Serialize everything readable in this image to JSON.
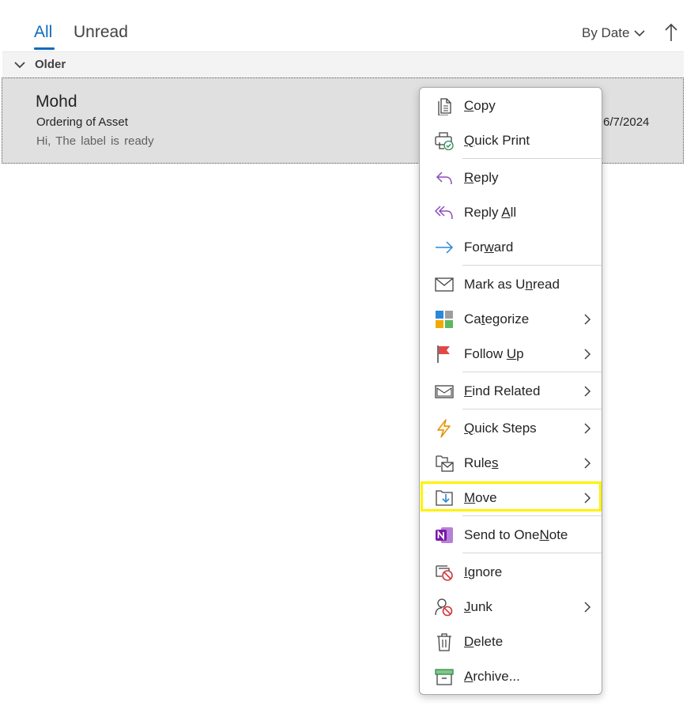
{
  "tabs": {
    "all": "All",
    "unread": "Unread"
  },
  "sort": {
    "label": "By Date"
  },
  "group": {
    "label": "Older"
  },
  "mail": {
    "sender": "Mohd",
    "subject": "Ordering of Asset",
    "preview": "Hi,  The label is ready",
    "date": "6/7/2024"
  },
  "menu": {
    "copy": {
      "pre": "",
      "key": "C",
      "post": "opy"
    },
    "quick_print": {
      "pre": "",
      "key": "Q",
      "post": "uick Print"
    },
    "reply": {
      "pre": "",
      "key": "R",
      "post": "eply"
    },
    "reply_all": {
      "pre": "Reply ",
      "key": "A",
      "post": "ll"
    },
    "forward": {
      "pre": "For",
      "key": "w",
      "post": "ard"
    },
    "mark_unread": {
      "pre": "Mark as U",
      "key": "n",
      "post": "read"
    },
    "categorize": {
      "pre": "Ca",
      "key": "t",
      "post": "egorize"
    },
    "follow_up": {
      "pre": "Follow ",
      "key": "U",
      "post": "p"
    },
    "find_related": {
      "pre": "",
      "key": "F",
      "post": "ind Related"
    },
    "quick_steps": {
      "pre": "",
      "key": "Q",
      "post": "uick Steps"
    },
    "rules": {
      "pre": "Rule",
      "key": "s",
      "post": ""
    },
    "move": {
      "pre": "",
      "key": "M",
      "post": "ove"
    },
    "onenote": {
      "pre": "Send to One",
      "key": "N",
      "post": "ote"
    },
    "ignore": {
      "pre": "",
      "key": "I",
      "post": "gnore"
    },
    "junk": {
      "pre": "",
      "key": "J",
      "post": "unk"
    },
    "delete": {
      "pre": "",
      "key": "D",
      "post": "elete"
    },
    "archive": {
      "pre": "",
      "key": "A",
      "post": "rchive..."
    }
  },
  "colors": {
    "accent": "#0f6cbd",
    "highlight": "#fff200",
    "selected_row": "#e0e0e0"
  }
}
